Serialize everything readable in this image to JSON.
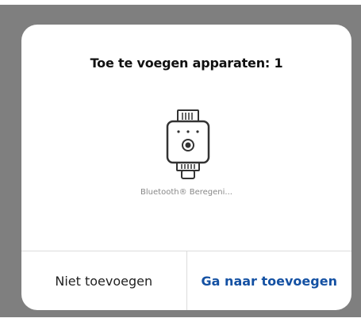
{
  "dialog": {
    "title": "Toe te voegen apparaten: 1",
    "device": {
      "icon": "bluetooth-sprinkler-device-icon",
      "label": "Bluetooth® Beregeni..."
    },
    "buttons": {
      "cancel_label": "Niet toevoegen",
      "confirm_label": "Ga naar toevoegen"
    }
  },
  "colors": {
    "backdrop": "#7f7f7f",
    "dialog_background": "#ffffff",
    "confirm_text": "#1451a3",
    "cancel_text": "#222222",
    "divider": "#dcdcdc",
    "icon_stroke": "#333333"
  }
}
